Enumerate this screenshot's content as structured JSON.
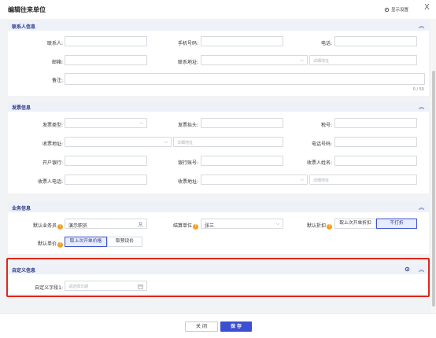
{
  "dialog": {
    "title": "编辑往来单位",
    "display_settings": "显示设置",
    "close": "X"
  },
  "contact": {
    "title": "联系人信息",
    "contact_person_label": "联系人:",
    "phone_label": "手机号码:",
    "tel_label": "电话:",
    "email_label": "邮箱:",
    "address_label": "联系地址:",
    "address_detail_placeholder": "详细地址",
    "remark_label": "备注:",
    "remark_counter": "0 / 50"
  },
  "invoice": {
    "title": "发票信息",
    "type_label": "发票类型:",
    "header_label": "发票抬头:",
    "tax_no_label": "税号:",
    "recv_addr_label": "收票地址:",
    "detail_placeholder": "详细地址",
    "tel_label": "电话号码:",
    "bank_label": "开户银行:",
    "account_label": "银行账号:",
    "recv_name_label": "收票人姓名:",
    "recv_tel_label": "收票人电话:",
    "recv_addr2_label": "收票地址:",
    "detail_placeholder2": "详细地址"
  },
  "business": {
    "title": "业务信息",
    "salesman_label": "默认业务员",
    "salesman_value": "演示职员",
    "settle_label": "结算单位",
    "settle_value": "张三",
    "discount_label": "默认折扣",
    "discount_option1": "取上次开单折扣",
    "discount_option2": "不打折",
    "price_label": "默认单价",
    "price_option1": "取上次开单价格",
    "price_option2": "取预设价"
  },
  "custom": {
    "title": "自定义信息",
    "field1_label": "自定义字段1:",
    "field1_placeholder": "请选择日期"
  },
  "footer": {
    "close": "关 闭",
    "save": "保 存"
  }
}
